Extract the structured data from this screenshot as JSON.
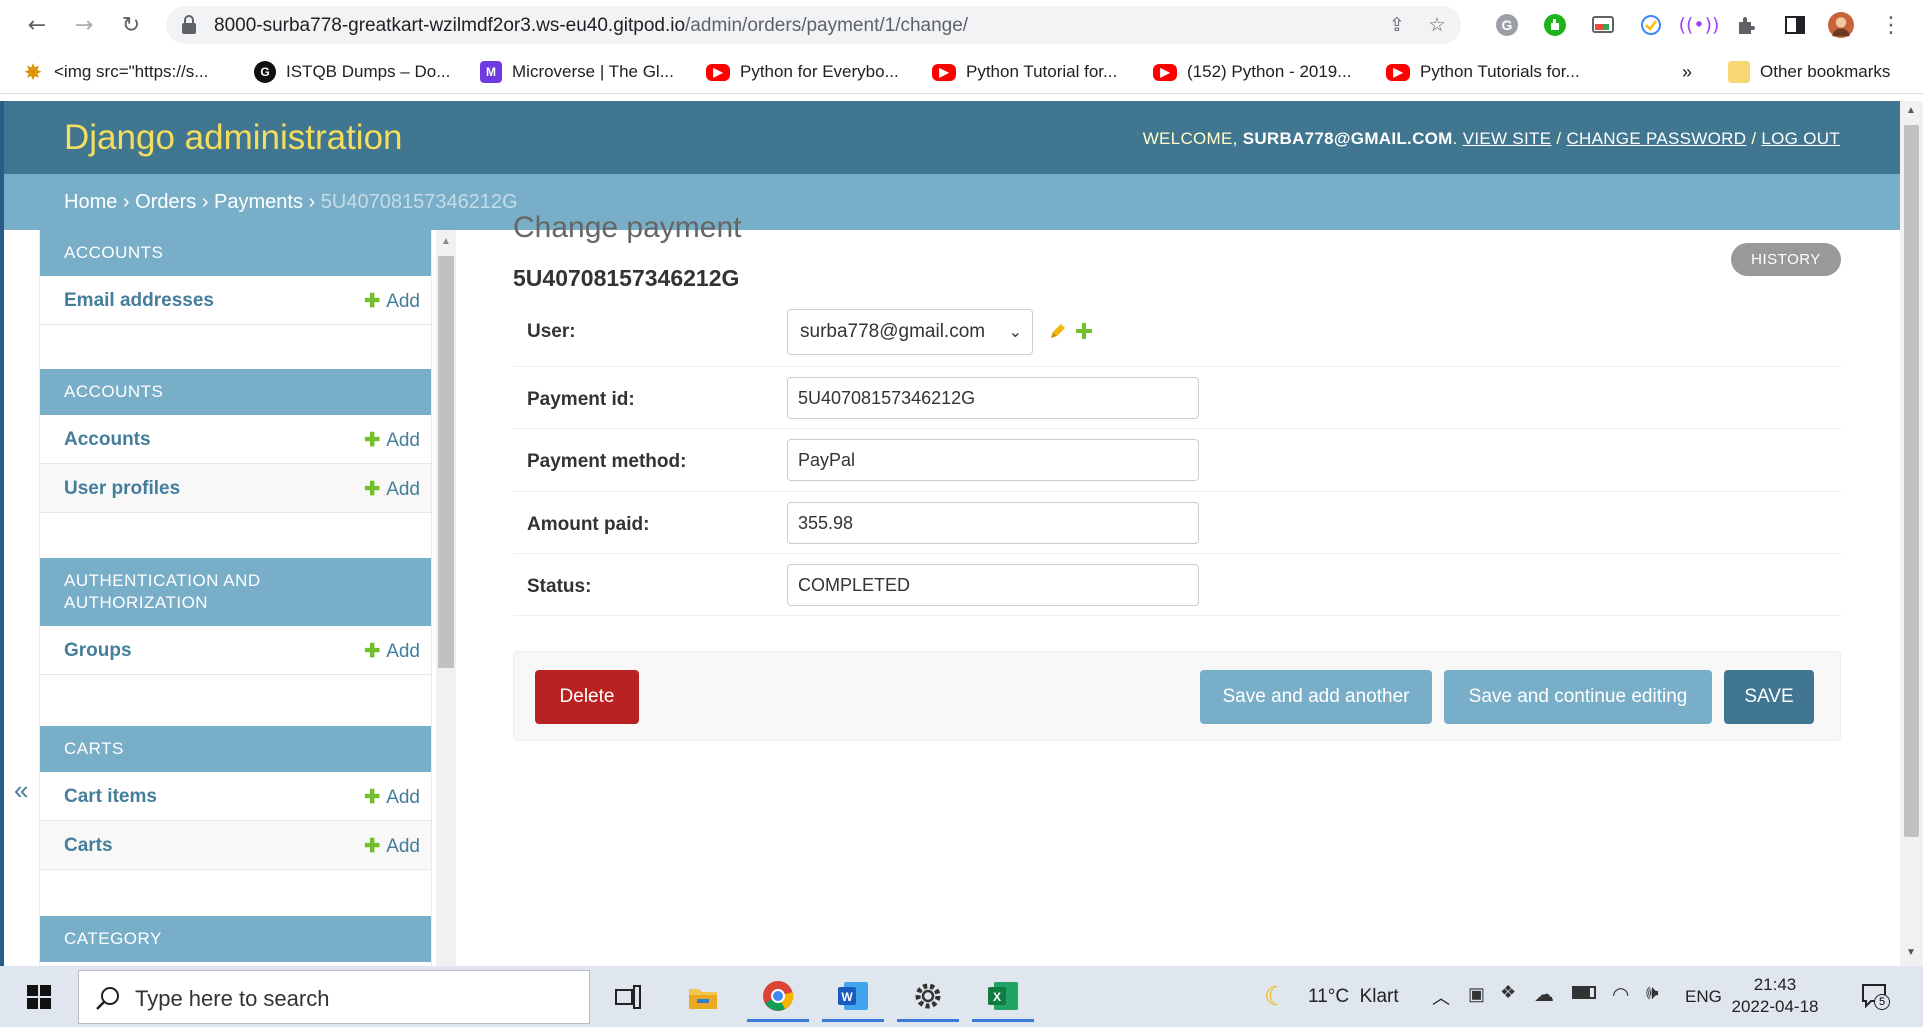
{
  "browser": {
    "url_host": "8000-surba778-greatkart-wzilmdf2or3.ws-eu40.gitpod.io",
    "url_path": "/admin/orders/payment/1/change/",
    "bookmarks": [
      {
        "label": "<img src=\"https://s...",
        "icon": "bee-icon"
      },
      {
        "label": "ISTQB Dumps – Do...",
        "icon": "g-icon"
      },
      {
        "label": "Microverse | The Gl...",
        "icon": "microverse-icon"
      },
      {
        "label": "Python for Everybo...",
        "icon": "youtube-icon"
      },
      {
        "label": "Python Tutorial for...",
        "icon": "youtube-icon"
      },
      {
        "label": "(152) Python - 2019...",
        "icon": "youtube-icon"
      },
      {
        "label": "Python Tutorials for...",
        "icon": "youtube-icon"
      }
    ],
    "more_bookmarks": "»",
    "other_bookmarks": "Other bookmarks"
  },
  "admin": {
    "brand": "Django administration",
    "welcome": "Welcome, ",
    "user_email": "surba778@gmail.com",
    "view_site": "View site",
    "change_password": "Change password",
    "log_out": "Log out",
    "sep1": ". ",
    "sep2": " / ",
    "sep3": " / "
  },
  "breadcrumbs": {
    "home": "Home",
    "orders": "Orders",
    "payments": "Payments",
    "current": "5U407081573462 12G",
    "sep": " › "
  },
  "sidebar": {
    "collapse": "«",
    "add_label": "Add",
    "modules": [
      {
        "title": "Accounts",
        "items": [
          "Email addresses"
        ]
      },
      {
        "title": "Accounts",
        "items": [
          "Accounts",
          "User profiles"
        ]
      },
      {
        "title": "Authentication and Authorization",
        "items": [
          "Groups"
        ]
      },
      {
        "title": "Carts",
        "items": [
          "Cart items",
          "Carts"
        ]
      },
      {
        "title": "Category",
        "items": []
      }
    ]
  },
  "content": {
    "title": "Change payment",
    "object_name": "5U40708157346212G",
    "history": "History",
    "fields": {
      "user_label": "User:",
      "user_value": "surba778@gmail.com",
      "payment_id_label": "Payment id:",
      "payment_id_value": "5U40708157346212G",
      "payment_method_label": "Payment method:",
      "payment_method_value": "PayPal",
      "amount_paid_label": "Amount paid:",
      "amount_paid_value": "355.98",
      "status_label": "Status:",
      "status_value": "COMPLETED"
    },
    "buttons": {
      "delete": "Delete",
      "save_add_another": "Save and add another",
      "save_continue": "Save and continue editing",
      "save": "SAVE"
    }
  },
  "taskbar": {
    "search_placeholder": "Type here to search",
    "weather": "11°C  Klart",
    "lang": "ENG",
    "time": "21:43",
    "date": "2022-04-18",
    "notifications": "5"
  },
  "colors": {
    "header": "#417690",
    "breadcrumbs": "#79aec8",
    "brand": "#f5dd5d",
    "delete": "#ba2121",
    "save": "#417690",
    "secondary": "#79aec8"
  }
}
